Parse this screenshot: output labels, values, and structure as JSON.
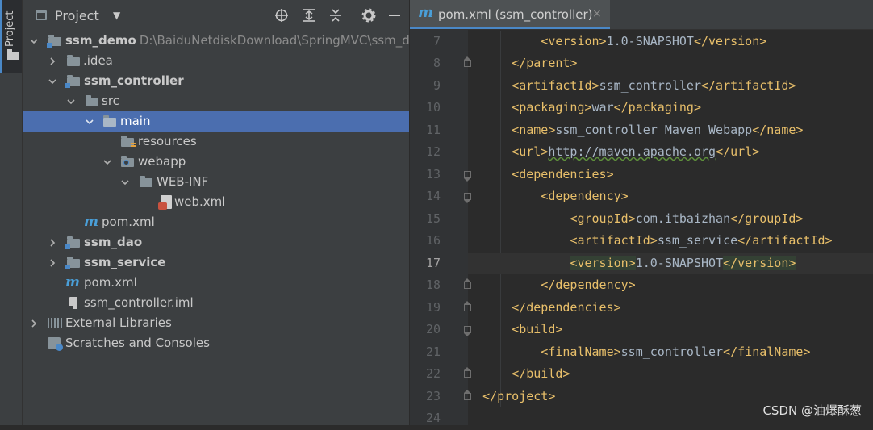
{
  "side_strip": {
    "label": "Project"
  },
  "project_panel": {
    "title": "Project",
    "dropdown": "▼",
    "toolbar": [
      "locate-icon",
      "expand-all-icon",
      "collapse-all-icon",
      "gear-icon",
      "hide-icon"
    ]
  },
  "tree": [
    {
      "label": "ssm_demo",
      "path": "D:\\BaiduNetdiskDownload\\SpringMVC\\ssm_de",
      "bold": true
    },
    {
      "label": ".idea"
    },
    {
      "label": "ssm_controller",
      "bold": true
    },
    {
      "label": "src"
    },
    {
      "label": "main"
    },
    {
      "label": "resources"
    },
    {
      "label": "webapp"
    },
    {
      "label": "WEB-INF"
    },
    {
      "label": "web.xml"
    },
    {
      "label": "pom.xml"
    },
    {
      "label": "ssm_dao",
      "bold": true
    },
    {
      "label": "ssm_service",
      "bold": true
    },
    {
      "label": "pom.xml"
    },
    {
      "label": "ssm_controller.iml"
    },
    {
      "label": "External Libraries"
    },
    {
      "label": "Scratches and Consoles"
    }
  ],
  "editor": {
    "tab_label": "pom.xml (ssm_controller)",
    "tab_close": "×",
    "line_numbers": [
      "7",
      "8",
      "9",
      "10",
      "11",
      "12",
      "13",
      "14",
      "15",
      "16",
      "17",
      "18",
      "19",
      "20",
      "21",
      "22",
      "23",
      "24"
    ],
    "current_line": "17",
    "lines": [
      {
        "indent": "        ",
        "open": "<version>",
        "text": "1.0-SNAPSHOT",
        "close": "</version>"
      },
      {
        "indent": "    ",
        "open": "</parent>",
        "text": "",
        "close": ""
      },
      {
        "indent": "    ",
        "open": "<artifactId>",
        "text": "ssm_controller",
        "close": "</artifactId>"
      },
      {
        "indent": "    ",
        "open": "<packaging>",
        "text": "war",
        "close": "</packaging>"
      },
      {
        "indent": "    ",
        "open": "<name>",
        "text": "ssm_controller Maven Webapp",
        "close": "</name>"
      },
      {
        "indent": "    ",
        "open": "<url>",
        "text": "http://maven.apache.org",
        "close": "</url>"
      },
      {
        "indent": "    ",
        "open": "<dependencies>",
        "text": "",
        "close": ""
      },
      {
        "indent": "        ",
        "open": "<dependency>",
        "text": "",
        "close": ""
      },
      {
        "indent": "            ",
        "open": "<groupId>",
        "text": "com.itbaizhan",
        "close": "</groupId>"
      },
      {
        "indent": "            ",
        "open": "<artifactId>",
        "text": "ssm_service",
        "close": "</artifactId>"
      },
      {
        "indent": "            ",
        "open": "<version>",
        "text": "1.0-SNAPSHOT",
        "close": "</version>"
      },
      {
        "indent": "        ",
        "open": "</dependency>",
        "text": "",
        "close": ""
      },
      {
        "indent": "    ",
        "open": "</dependencies>",
        "text": "",
        "close": ""
      },
      {
        "indent": "    ",
        "open": "<build>",
        "text": "",
        "close": ""
      },
      {
        "indent": "        ",
        "open": "<finalName>",
        "text": "ssm_controller",
        "close": "</finalName>"
      },
      {
        "indent": "    ",
        "open": "</build>",
        "text": "",
        "close": ""
      },
      {
        "indent": "",
        "open": "</project>",
        "text": "",
        "close": ""
      },
      {
        "indent": "",
        "open": "",
        "text": "",
        "close": ""
      }
    ]
  },
  "watermark": "CSDN @油爆酥葱",
  "colors": {
    "selection": "#4b6eaf",
    "accent": "#4a88c7",
    "tag": "#e8bf6a",
    "text": "#a9b7c6"
  }
}
